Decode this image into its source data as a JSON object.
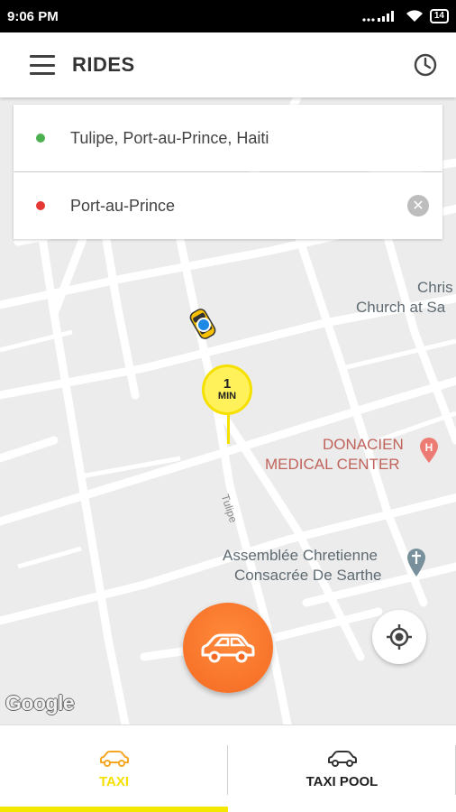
{
  "status_bar": {
    "time": "9:06 PM",
    "battery": "14"
  },
  "header": {
    "title": "RIDES",
    "menu_icon": "hamburger-menu-icon",
    "history_icon": "clock-icon"
  },
  "route": {
    "pickup": "Tulipe, Port-au-Prince, Haiti",
    "pickup_color": "#4caf50",
    "dropoff": "Port-au-Prince",
    "dropoff_color": "#e53935"
  },
  "map": {
    "eta_value": "1",
    "eta_unit": "MIN",
    "poi_church_1": "Chris",
    "poi_church_2": "Church at Sa",
    "poi_medical_1": "DONACIEN",
    "poi_medical_2": "MEDICAL CENTER",
    "poi_assembly_1": "Assemblée Chretienne",
    "poi_assembly_2": "Consacrée De Sarthe",
    "street": "Tulipe",
    "attribution": "Google"
  },
  "tabs": [
    {
      "label": "TAXI",
      "active": true
    },
    {
      "label": "TAXI POOL",
      "active": false
    }
  ],
  "colors": {
    "accent_yellow": "#f5e000",
    "book_orange": "#f46a22"
  }
}
